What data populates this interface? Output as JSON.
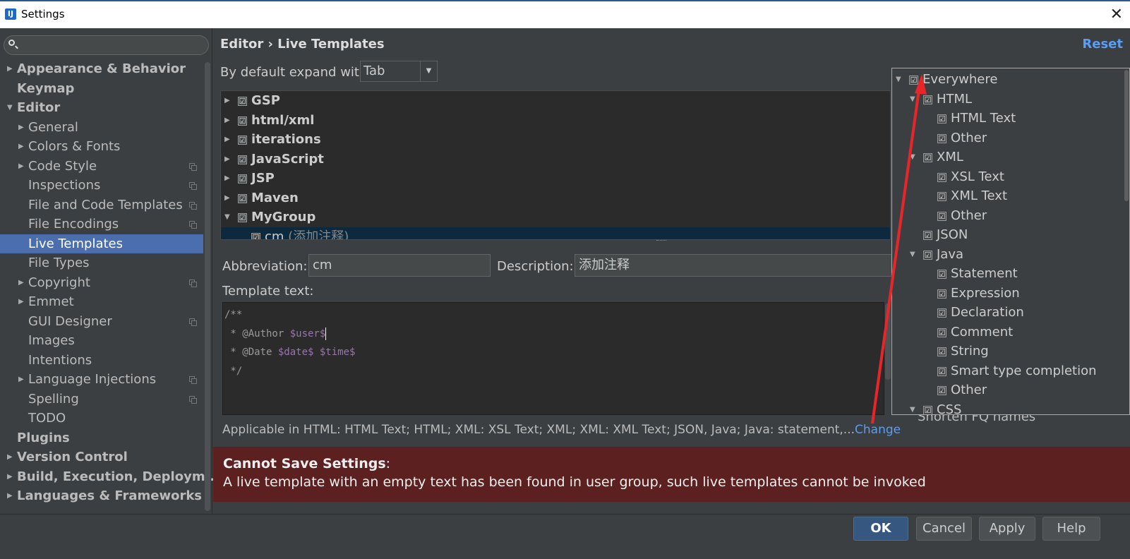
{
  "window": {
    "title": "Settings",
    "close_glyph": "✕"
  },
  "sidebar": {
    "search_placeholder": "",
    "items": [
      {
        "label": "Appearance & Behavior",
        "bold": true,
        "arrow": "▶",
        "level": 0
      },
      {
        "label": "Keymap",
        "bold": true,
        "arrow": "",
        "level": 0
      },
      {
        "label": "Editor",
        "bold": true,
        "arrow": "▼",
        "level": 0
      },
      {
        "label": "General",
        "arrow": "▶",
        "level": 1
      },
      {
        "label": "Colors & Fonts",
        "arrow": "▶",
        "level": 1
      },
      {
        "label": "Code Style",
        "arrow": "▶",
        "level": 1,
        "copy": true
      },
      {
        "label": "Inspections",
        "arrow": "",
        "level": 1,
        "copy": true
      },
      {
        "label": "File and Code Templates",
        "arrow": "",
        "level": 1,
        "copy": true
      },
      {
        "label": "File Encodings",
        "arrow": "",
        "level": 1,
        "copy": true
      },
      {
        "label": "Live Templates",
        "arrow": "",
        "level": 1,
        "selected": true
      },
      {
        "label": "File Types",
        "arrow": "",
        "level": 1
      },
      {
        "label": "Copyright",
        "arrow": "▶",
        "level": 1,
        "copy": true
      },
      {
        "label": "Emmet",
        "arrow": "▶",
        "level": 1
      },
      {
        "label": "GUI Designer",
        "arrow": "",
        "level": 1,
        "copy": true
      },
      {
        "label": "Images",
        "arrow": "",
        "level": 1
      },
      {
        "label": "Intentions",
        "arrow": "",
        "level": 1
      },
      {
        "label": "Language Injections",
        "arrow": "▶",
        "level": 1,
        "copy": true
      },
      {
        "label": "Spelling",
        "arrow": "",
        "level": 1,
        "copy": true
      },
      {
        "label": "TODO",
        "arrow": "",
        "level": 1
      },
      {
        "label": "Plugins",
        "bold": true,
        "arrow": "",
        "level": 0
      },
      {
        "label": "Version Control",
        "bold": true,
        "arrow": "▶",
        "level": 0
      },
      {
        "label": "Build, Execution, Deploym...",
        "bold": true,
        "arrow": "▶",
        "level": 0
      },
      {
        "label": "Languages & Frameworks",
        "bold": true,
        "arrow": "▶",
        "level": 0
      }
    ]
  },
  "header": {
    "breadcrumb": "Editor › Live Templates",
    "reset_label": "Reset"
  },
  "expand": {
    "label": "By default expand with",
    "value": "Tab",
    "dropdown_glyph": "▼"
  },
  "groups": [
    {
      "label": "GSP",
      "arrow": "▶",
      "checked": "☑"
    },
    {
      "label": "html/xml",
      "arrow": "▶",
      "checked": "☑"
    },
    {
      "label": "iterations",
      "arrow": "▶",
      "checked": "☑"
    },
    {
      "label": "JavaScript",
      "arrow": "▶",
      "checked": "☑"
    },
    {
      "label": "JSP",
      "arrow": "▶",
      "checked": "☑"
    },
    {
      "label": "Maven",
      "arrow": "▶",
      "checked": "☑"
    },
    {
      "label": "MyGroup",
      "arrow": "▼",
      "checked": "☑"
    }
  ],
  "selected_template": {
    "abbr": "cm",
    "desc": "(添加注释)"
  },
  "form": {
    "abbreviation_label": "Abbreviation:",
    "abbreviation_value": "cm",
    "description_label": "Description:",
    "description_value": "添加注释",
    "template_text_label": "Template text:"
  },
  "template_text": {
    "line1": "/**",
    "line2_prefix": " * @Author ",
    "line2_var": "$user$",
    "line3_prefix": " * @Date ",
    "line3_var1": "$date$",
    "line3_var2": "$time$",
    "line4": " */"
  },
  "applicable": {
    "text": "Applicable in HTML: HTML Text; HTML; XML: XSL Text; XML; XML: XML Text; JSON, Java; Java: statement,...",
    "change_label": "Change"
  },
  "error": {
    "title": "Cannot Save Settings",
    "colon": ":",
    "message": "A live template with an empty text has been found in user group, such live templates cannot be invoked"
  },
  "context_popup": {
    "items": [
      {
        "label": "Everywhere",
        "arrow": "▼",
        "level": 0
      },
      {
        "label": "HTML",
        "arrow": "▼",
        "level": 1
      },
      {
        "label": "HTML Text",
        "arrow": "",
        "level": 2
      },
      {
        "label": "Other",
        "arrow": "",
        "level": 2
      },
      {
        "label": "XML",
        "arrow": "▼",
        "level": 1
      },
      {
        "label": "XSL Text",
        "arrow": "",
        "level": 2
      },
      {
        "label": "XML Text",
        "arrow": "",
        "level": 2
      },
      {
        "label": "Other",
        "arrow": "",
        "level": 2
      },
      {
        "label": "JSON",
        "arrow": "",
        "level": 1
      },
      {
        "label": "Java",
        "arrow": "▼",
        "level": 1
      },
      {
        "label": "Statement",
        "arrow": "",
        "level": 2
      },
      {
        "label": "Expression",
        "arrow": "",
        "level": 2
      },
      {
        "label": "Declaration",
        "arrow": "",
        "level": 2
      },
      {
        "label": "Comment",
        "arrow": "",
        "level": 2
      },
      {
        "label": "String",
        "arrow": "",
        "level": 2
      },
      {
        "label": "Smart type completion",
        "arrow": "",
        "level": 2
      },
      {
        "label": "Other",
        "arrow": "",
        "level": 2
      },
      {
        "label": "CSS",
        "arrow": "▼",
        "level": 1
      }
    ],
    "checkbox_glyph": "☑",
    "behind_text": "Shorten FQ names"
  },
  "footer": {
    "ok": "OK",
    "cancel": "Cancel",
    "apply": "Apply",
    "help": "Help"
  },
  "colors": {
    "accent": "#589df6",
    "selection": "#4b6eaf",
    "error_bg": "#5c2020",
    "annotation_arrow": "#e8262a"
  }
}
